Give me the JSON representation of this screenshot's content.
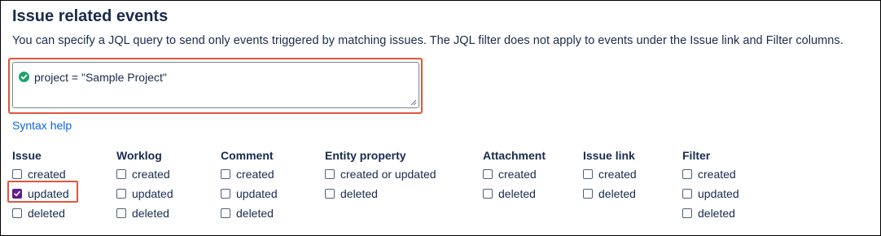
{
  "title": "Issue related events",
  "description": "You can specify a JQL query to send only events triggered by matching issues. The JQL filter does not apply to events under the Issue link and Filter columns.",
  "jql": {
    "value": "project = \"Sample Project\"",
    "status_icon": "check-circle-icon",
    "status_color": "#22a06b"
  },
  "syntax_help": "Syntax help",
  "colors": {
    "highlight": "#e2553a",
    "checkbox_checked": "#5e1d8a",
    "link": "#0c66e4"
  },
  "columns": [
    {
      "header": "Issue",
      "options": [
        {
          "label": "created",
          "checked": false
        },
        {
          "label": "updated",
          "checked": true
        },
        {
          "label": "deleted",
          "checked": false
        }
      ]
    },
    {
      "header": "Worklog",
      "options": [
        {
          "label": "created",
          "checked": false
        },
        {
          "label": "updated",
          "checked": false
        },
        {
          "label": "deleted",
          "checked": false
        }
      ]
    },
    {
      "header": "Comment",
      "options": [
        {
          "label": "created",
          "checked": false
        },
        {
          "label": "updated",
          "checked": false
        },
        {
          "label": "deleted",
          "checked": false
        }
      ]
    },
    {
      "header": "Entity property",
      "options": [
        {
          "label": "created or updated",
          "checked": false
        },
        {
          "label": "deleted",
          "checked": false
        }
      ]
    },
    {
      "header": "Attachment",
      "options": [
        {
          "label": "created",
          "checked": false
        },
        {
          "label": "deleted",
          "checked": false
        }
      ]
    },
    {
      "header": "Issue link",
      "options": [
        {
          "label": "created",
          "checked": false
        },
        {
          "label": "deleted",
          "checked": false
        }
      ]
    },
    {
      "header": "Filter",
      "options": [
        {
          "label": "created",
          "checked": false
        },
        {
          "label": "updated",
          "checked": false
        },
        {
          "label": "deleted",
          "checked": false
        }
      ]
    }
  ]
}
